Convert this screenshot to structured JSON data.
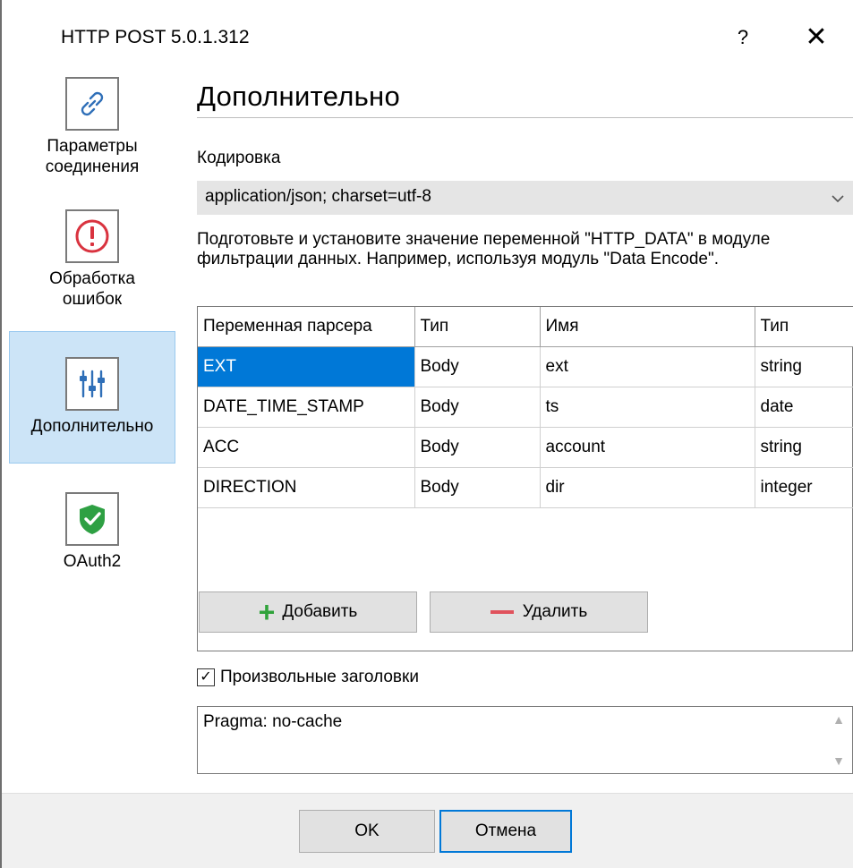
{
  "window": {
    "title": "HTTP POST 5.0.1.312",
    "help_label": "?",
    "close_label": "✕"
  },
  "sidebar": {
    "items": [
      {
        "label": "Параметры соединения",
        "icon": "link-icon",
        "active": false
      },
      {
        "label": "Обработка ошибок",
        "icon": "error-icon",
        "active": false
      },
      {
        "label": "Дополнительно",
        "icon": "sliders-icon",
        "active": true
      },
      {
        "label": "OAuth2",
        "icon": "shield-check-icon",
        "active": false
      }
    ]
  },
  "main": {
    "title": "Дополнительно",
    "encoding_label": "Кодировка",
    "encoding_value": "application/json; charset=utf-8",
    "hint": "Подготовьте и установите значение переменной \"HTTP_DATA\" в модуле фильтрации данных. Например, используя модуль \"Data Encode\".",
    "table": {
      "columns": [
        "Переменная парсера",
        "Тип",
        "Имя",
        "Тип"
      ],
      "rows": [
        [
          "EXT",
          "Body",
          "ext",
          "string"
        ],
        [
          "DATE_TIME_STAMP",
          "Body",
          "ts",
          "date"
        ],
        [
          "ACC",
          "Body",
          "account",
          "string"
        ],
        [
          "DIRECTION",
          "Body",
          "dir",
          "integer"
        ]
      ]
    },
    "add_label": "Добавить",
    "remove_label": "Удалить",
    "custom_headers_label": "Произвольные заголовки",
    "custom_headers_checked": true,
    "custom_headers_value": "Pragma: no-cache"
  },
  "footer": {
    "ok_label": "OK",
    "cancel_label": "Отмена"
  },
  "colors": {
    "accent": "#0078d7",
    "active_nav": "#cce4f7",
    "add_green": "#2fa33a",
    "remove_red": "#e0525c",
    "error_red": "#d9333f",
    "shield_green": "#2ea043"
  }
}
